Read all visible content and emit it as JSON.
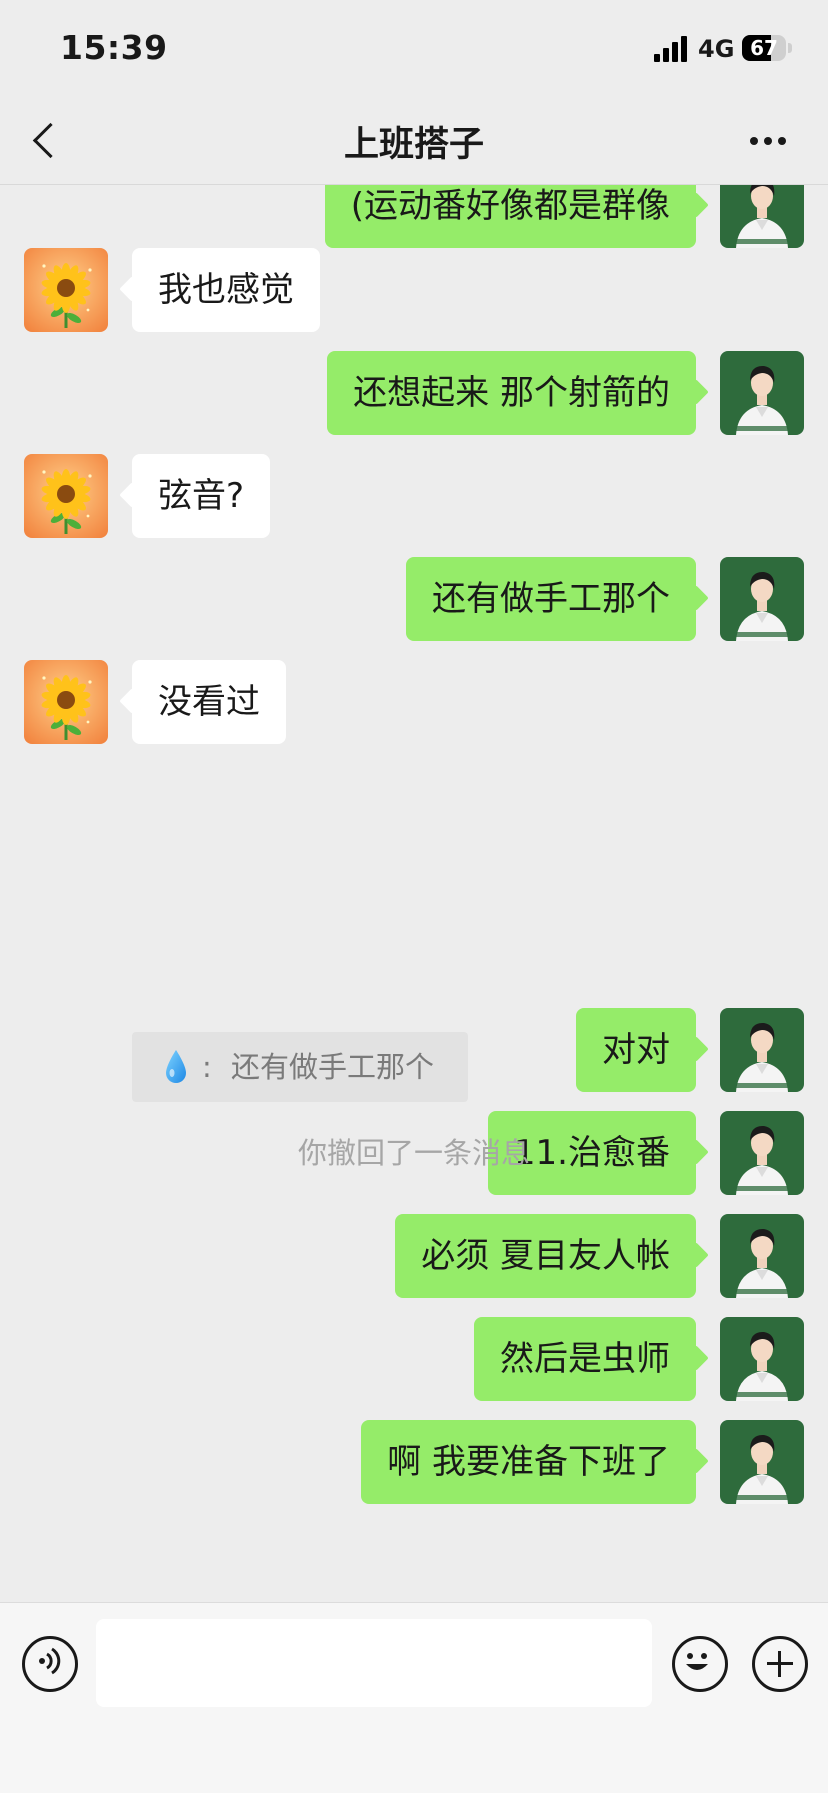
{
  "status_bar": {
    "time": "15:39",
    "network": "4G",
    "battery": "67",
    "battery_level": 0.67
  },
  "header": {
    "title": "上班搭子"
  },
  "avatars": {
    "self": "anime-boy-portrait",
    "other": "sunflower"
  },
  "messages": [
    {
      "side": "right",
      "text": "(运动番好像都是群像"
    },
    {
      "side": "left",
      "text": "我也感觉"
    },
    {
      "side": "right",
      "text": "还想起来 那个射箭的"
    },
    {
      "side": "left",
      "text": "弦音?"
    },
    {
      "side": "right",
      "text": "还有做手工那个"
    },
    {
      "side": "left",
      "text": "没看过"
    },
    {
      "side": "right",
      "text": "对对"
    },
    {
      "side": "right",
      "text": "11.治愈番"
    },
    {
      "side": "right",
      "text": "必须 夏目友人帐"
    },
    {
      "side": "right",
      "text": "然后是虫师"
    },
    {
      "side": "right",
      "text": "啊 我要准备下班了"
    }
  ],
  "quote": {
    "sender_icon": "water-drop",
    "separator": ":",
    "text": "还有做手工那个"
  },
  "system_message": "你撤回了一条消息",
  "input_bar": {
    "value": ""
  },
  "colors": {
    "background": "#ededed",
    "bubble_self": "#95ec69",
    "bubble_other": "#ffffff"
  }
}
